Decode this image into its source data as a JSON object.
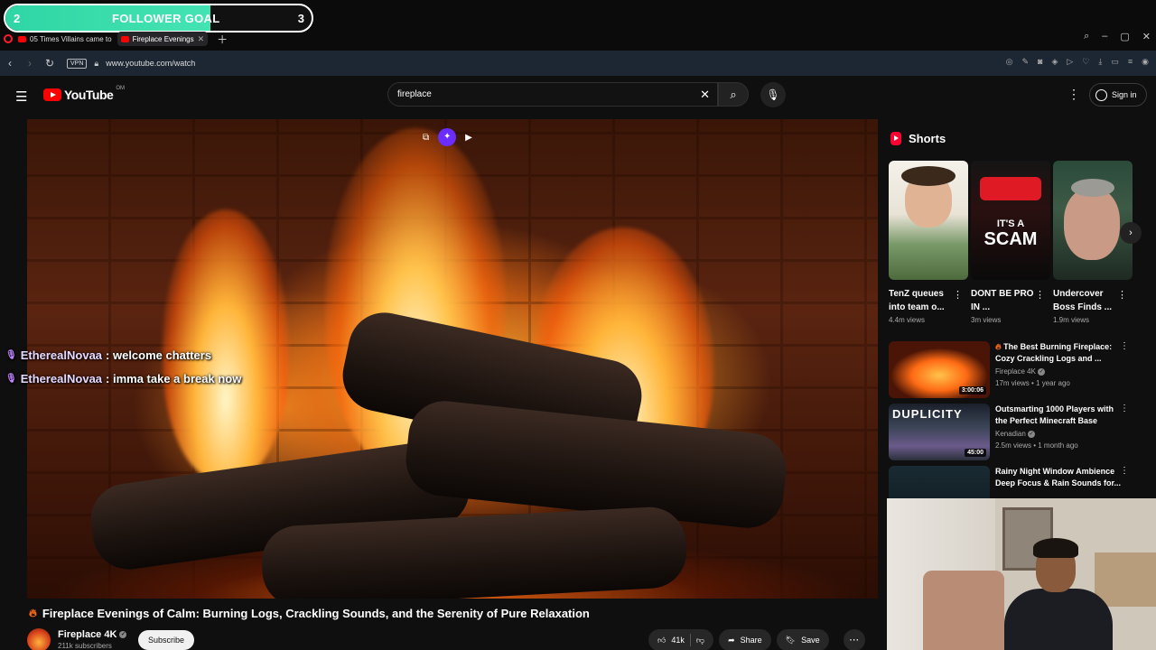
{
  "follower_goal": {
    "left_num": "2",
    "label": "FOLLOWER GOAL",
    "right_num": "3",
    "progress": 0.67
  },
  "tabs": [
    {
      "title": "05 Times Villains came to"
    },
    {
      "title": "Fireplace Evenings"
    }
  ],
  "address": {
    "vpn": "VPN",
    "url": "www.youtube.com/watch"
  },
  "youtube": {
    "logo_word": "YouTube",
    "country": "OM",
    "search_query": "fireplace",
    "sign_in": "Sign in"
  },
  "chat": [
    {
      "user": "EtherealNovaa",
      "message": " : welcome chatters"
    },
    {
      "user": "EtherealNovaa",
      "message": " : imma take a break now"
    }
  ],
  "video": {
    "title": "Fireplace Evenings of Calm: Burning Logs, Crackling Sounds, and the Serenity of Pure Relaxation",
    "channel": "Fireplace 4K",
    "subscribers": "211k subscribers",
    "subscribe_label": "Subscribe",
    "likes": "41k",
    "share_label": "Share",
    "save_label": "Save"
  },
  "shorts": {
    "heading": "Shorts",
    "items": [
      {
        "title": "TenZ queues into team o...",
        "views": "4.4m views"
      },
      {
        "title": "DONT BE PRO IN ...",
        "views": "3m views",
        "overlay_top": "IT'S A",
        "overlay_main": "SCAM"
      },
      {
        "title": "Undercover Boss Finds ...",
        "views": "1.9m views"
      }
    ]
  },
  "recommended": [
    {
      "title": "The Best Burning Fireplace: Cozy Crackling Logs and ...",
      "channel": "Fireplace 4K",
      "meta": "17m views • 1 year ago",
      "duration": "3:00:06"
    },
    {
      "title": "Outsmarting 1000 Players with the Perfect Minecraft Base",
      "channel": "Kenadian",
      "meta": "2.5m views • 1 month ago",
      "duration": "45:00",
      "thumb_text": "DUPLICITY"
    },
    {
      "title": "Rainy Night Window Ambience Deep Focus & Rain Sounds for...",
      "channel": "",
      "meta": "",
      "duration": ""
    }
  ],
  "colors": {
    "accent_red": "#ff0000",
    "goal_green": "#2fd6a5",
    "bg": "#0f0f0f",
    "chat_purple": "#c080ff"
  }
}
